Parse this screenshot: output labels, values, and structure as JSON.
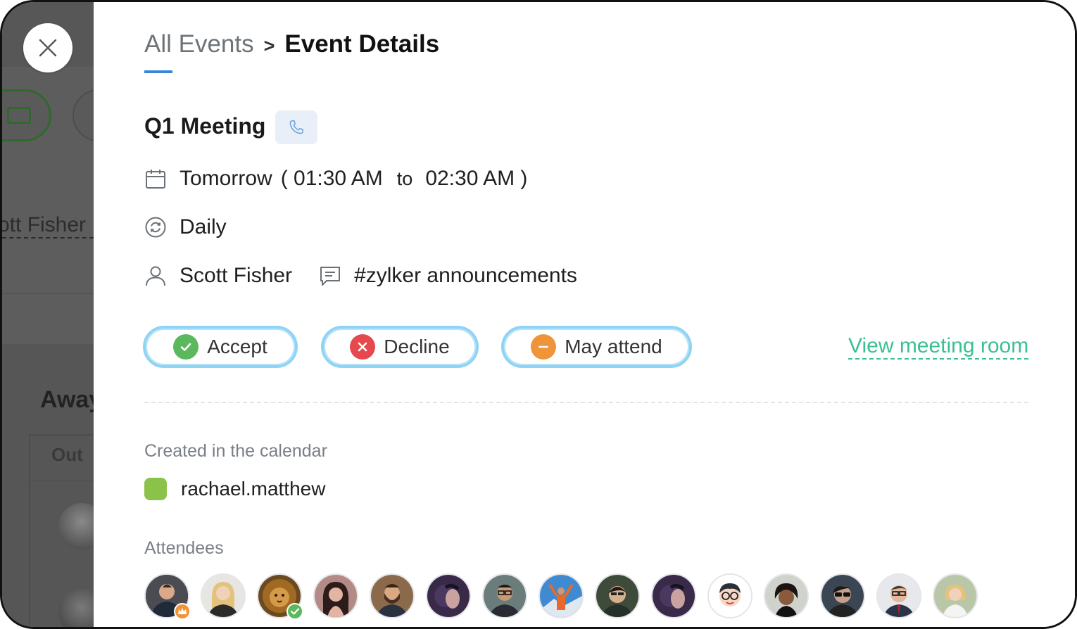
{
  "breadcrumb": {
    "root": "All Events",
    "separator": ">",
    "current": "Event Details"
  },
  "event": {
    "title": "Q1 Meeting",
    "call_icon": "phone-icon",
    "when": "Tomorrow",
    "start": "( 01:30 AM",
    "to_word": "to",
    "end": "02:30 AM )",
    "recurrence": "Daily",
    "organizer": "Scott Fisher",
    "channel": "#zylker announcements"
  },
  "rsvp": {
    "accept_label": "Accept",
    "decline_label": "Decline",
    "maybe_label": "May attend",
    "accept_color": "#5cb85c",
    "decline_color": "#e5484d",
    "maybe_color": "#f0943a"
  },
  "view_room_label": "View meeting room",
  "calendar": {
    "section_label": "Created in the calendar",
    "name": "rachael.matthew",
    "color": "#8bc34a"
  },
  "attendees": {
    "section_label": "Attendees",
    "count_shown": 15
  },
  "background": {
    "partial_name": "ott Fisher",
    "section_heading": "Away",
    "column_heading": "Out"
  },
  "colors": {
    "accent_blue": "#3a86d6",
    "link_green": "#3cbf91",
    "button_outline": "#8fd4f4"
  }
}
